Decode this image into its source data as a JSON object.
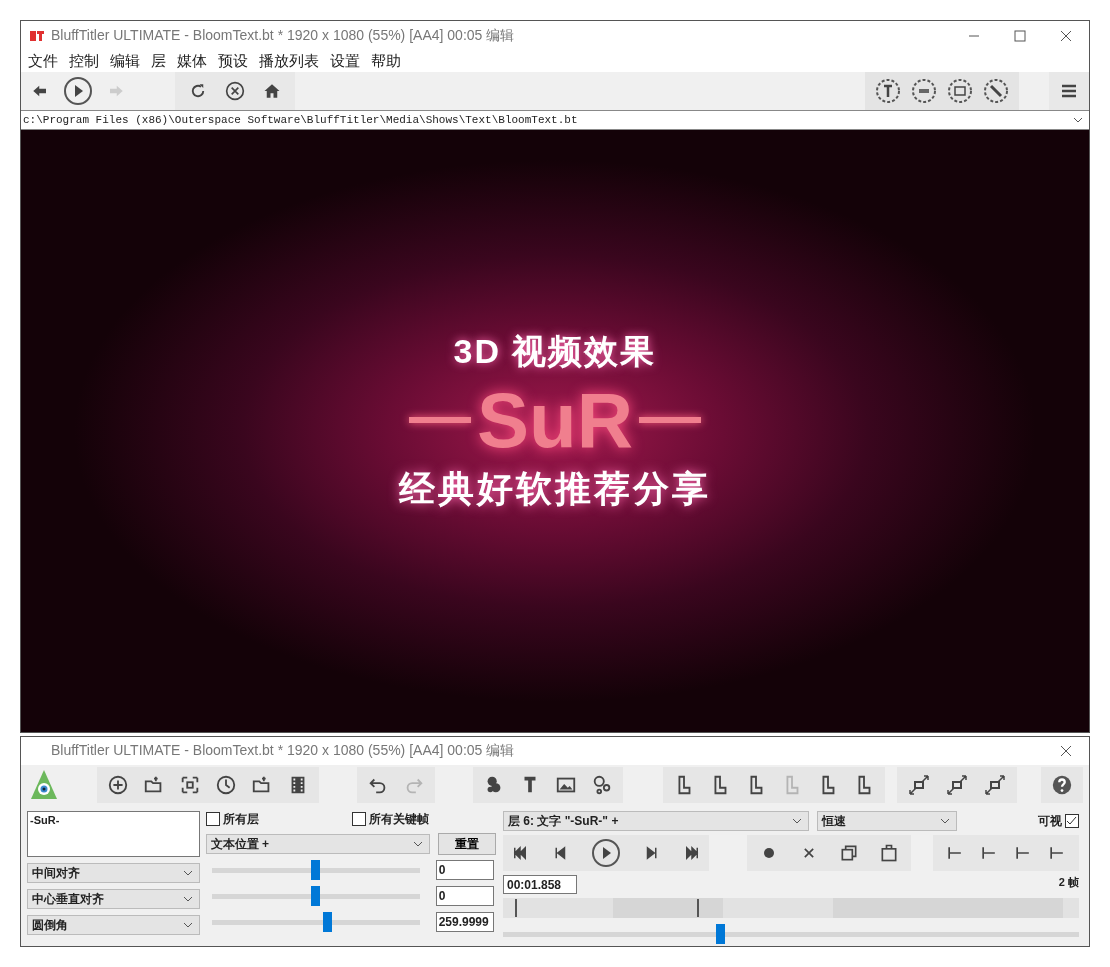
{
  "main_window": {
    "title": "BluffTitler ULTIMATE  - BloomText.bt * 1920 x 1080 (55%) [AA4] 00:05 编辑"
  },
  "menu": [
    "文件",
    "控制",
    "编辑",
    "层",
    "媒体",
    "预设",
    "播放列表",
    "设置",
    "帮助"
  ],
  "toolbar": {
    "forward": {
      "disabled": true
    }
  },
  "path_field": {
    "value": "c:\\Program Files (x86)\\Outerspace Software\\BluffTitler\\Media\\Shows\\Text\\BloomText.bt"
  },
  "preview": {
    "lines": [
      "3D 视频效果",
      "SuR",
      "经典好软推荐分享"
    ]
  },
  "panel_window": {
    "title": "BluffTitler ULTIMATE  - BloomText.bt * 1920 x 1080 (55%) [AA4] 00:05 编辑"
  },
  "panel_toolbar": {
    "redo": {
      "disabled": true
    },
    "layer_tools": [
      {
        "disabled": false
      },
      {
        "disabled": false
      },
      {
        "disabled": false
      },
      {
        "disabled": true
      },
      {
        "disabled": false
      },
      {
        "disabled": false
      }
    ]
  },
  "text_field": {
    "value": "-SuR-"
  },
  "all_layers": {
    "label": "所有层",
    "checked": false
  },
  "all_keyframes": {
    "label": "所有关键帧",
    "checked": false
  },
  "property_dropdown": {
    "value": "文本位置 +"
  },
  "reset_button": "重置",
  "params": [
    {
      "dropdown": "中间对齐",
      "level": 0.5,
      "value": "0"
    },
    {
      "dropdown": "中心垂直对齐",
      "level": 0.5,
      "value": "0"
    },
    {
      "dropdown": "圆倒角",
      "level": 0.56,
      "value": "259.9999"
    }
  ],
  "layer_dropdown": {
    "value": "层   6: 文字 \"-SuR-\" +"
  },
  "speed_dropdown": {
    "value": "恒速"
  },
  "visible": {
    "label": "可视",
    "checked": true
  },
  "time_field": {
    "value": "00:01.858"
  },
  "frames_label": "2 帧",
  "timeline": {
    "level": 0.375
  }
}
